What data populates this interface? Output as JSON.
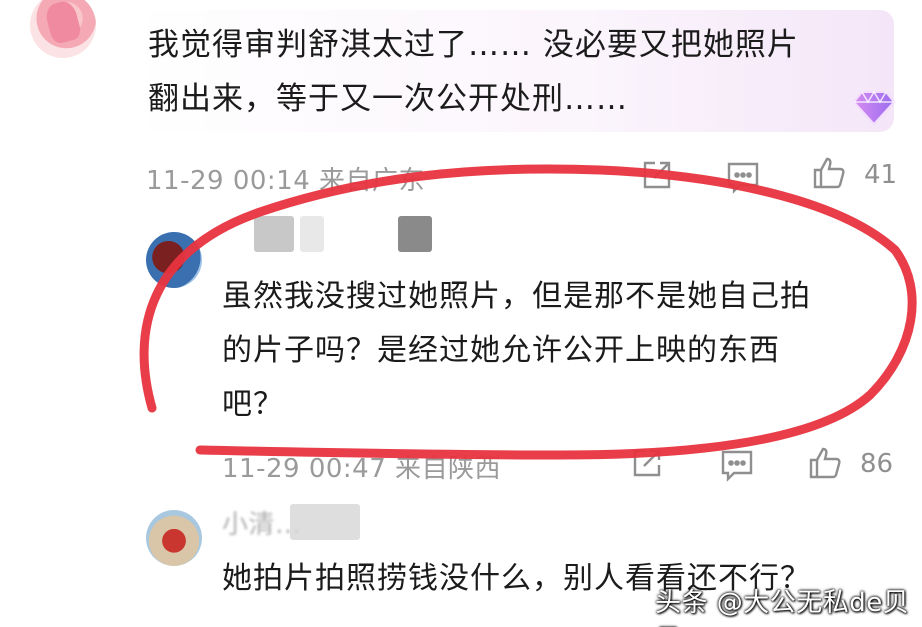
{
  "comment1": {
    "text_line1": "我觉得审判舒淇太过了…… 没必要又把她照片",
    "text_line2": "翻出来，等于又一次公开处刑……",
    "meta": "11-29 00:14 来自广东",
    "likes": "41"
  },
  "reply1": {
    "text_line1": "虽然我没搜过她照片，但是那不是她自己拍",
    "text_line2": "的片子吗？是经过她允许公开上映的东西",
    "text_line3": "吧？",
    "meta": "11-29 00:47 来自陕西",
    "likes": "86"
  },
  "reply2": {
    "name": "小清…",
    "text_line1": "她拍片拍照捞钱没什么，别人看看还不行？"
  },
  "watermark": "头条 @大公无私de贝贝",
  "colors": {
    "annotation": "#e8343f",
    "meta_gray": "#9a9a9a",
    "bubble_tint": "#f4e6f8"
  },
  "icons": [
    "share-icon",
    "comment-icon",
    "like-icon",
    "vip-badge-icon"
  ]
}
